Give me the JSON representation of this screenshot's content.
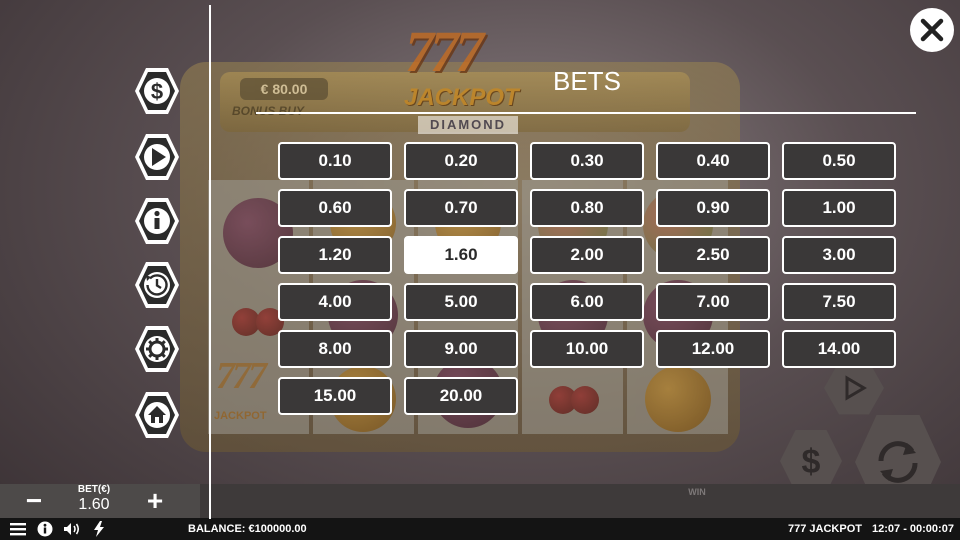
{
  "game": {
    "bonus_buy_price": "€ 80.00",
    "bonus_buy_label": "BONUS BUY",
    "logo_top": "777",
    "logo_bottom": "JACKPOT",
    "logo_sub": "DIAMOND",
    "reel_symbol_777": "777",
    "reel_symbol_jackpot": "JACKPOT"
  },
  "menu": {
    "title": "BETS",
    "bet_options": [
      "0.10",
      "0.20",
      "0.30",
      "0.40",
      "0.50",
      "0.60",
      "0.70",
      "0.80",
      "0.90",
      "1.00",
      "1.20",
      "1.60",
      "2.00",
      "2.50",
      "3.00",
      "4.00",
      "5.00",
      "6.00",
      "7.00",
      "7.50",
      "8.00",
      "9.00",
      "10.00",
      "12.00",
      "14.00",
      "15.00",
      "20.00"
    ],
    "selected_bet": "1.60",
    "side_icons": [
      "dollar-icon",
      "play-icon",
      "info-icon",
      "history-icon",
      "settings-icon",
      "home-icon"
    ]
  },
  "bet_bar": {
    "minus": "−",
    "plus": "+",
    "label": "BET(€)",
    "value": "1.60",
    "win_label": "WIN"
  },
  "status": {
    "balance": "BALANCE: €100000.00",
    "game_title": "777 JACKPOT",
    "clock": "12:07 - 00:00:07"
  },
  "colors": {
    "accent": "#ffffff",
    "button_bg": "#3a3838",
    "selected_bg": "#ffffff"
  }
}
